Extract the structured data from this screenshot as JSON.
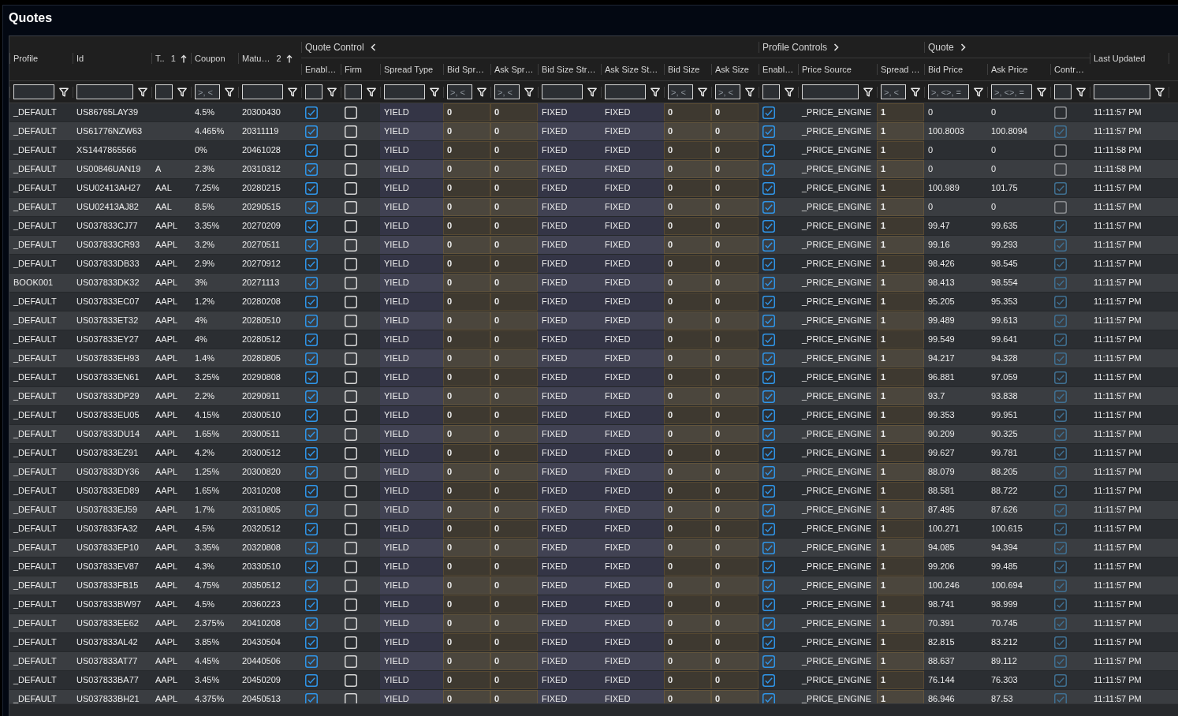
{
  "title": "Quotes",
  "grid": {
    "headers": [
      {
        "kind": "text",
        "label": "Profile"
      },
      {
        "kind": "text",
        "label": "Id"
      },
      {
        "kind": "text",
        "label": "T..",
        "sort_index": "1",
        "ascending": true
      },
      {
        "kind": "text",
        "label": "Coupon",
        "filter_placeholder": ">, <"
      },
      {
        "kind": "text",
        "label": "Matu…",
        "sort_index": "2",
        "ascending": true
      },
      {
        "kind": "group",
        "label": "Quote Control",
        "expanded": true,
        "columns": [
          {
            "kind": "check",
            "label": "Enabl…"
          },
          {
            "kind": "check",
            "label": "Firm"
          },
          {
            "kind": "choice",
            "label": "Spread Type"
          },
          {
            "kind": "entry",
            "label": "Bid Spr…",
            "filter_placeholder": ">, <"
          },
          {
            "kind": "entry",
            "label": "Ask Spr…",
            "filter_placeholder": ">, <"
          },
          {
            "kind": "choice",
            "label": "Bid Size Str…"
          },
          {
            "kind": "choice",
            "label": "Ask Size St…"
          },
          {
            "kind": "entry",
            "label": "Bid Size",
            "filter_placeholder": ">, <"
          },
          {
            "kind": "entry",
            "label": "Ask Size",
            "filter_placeholder": ">, <"
          }
        ]
      },
      {
        "kind": "group",
        "label": "Profile Controls",
        "expanded": false,
        "columns": [
          {
            "kind": "check",
            "label": "Enabl…"
          },
          {
            "kind": "text",
            "label": "Price Source"
          },
          {
            "kind": "entry",
            "label": "Spread …",
            "filter_placeholder": ">, <"
          }
        ]
      },
      {
        "kind": "group",
        "label": "Quote",
        "expanded": false,
        "columns": [
          {
            "kind": "text",
            "label": "Bid Price",
            "filter_placeholder": ">, <>, ="
          },
          {
            "kind": "text",
            "label": "Ask Price",
            "filter_placeholder": ">, <>, ="
          },
          {
            "kind": "flag",
            "label": "Contr…"
          }
        ]
      },
      {
        "kind": "text",
        "label": "Last Updated"
      }
    ],
    "rows": [
      {
        "cells": [
          "_DEFAULT",
          "US86765LAY39",
          null,
          "4.5%",
          "20300430",
          true,
          false,
          "YIELD",
          "0",
          "0",
          "FIXED",
          "FIXED",
          "0",
          "0",
          true,
          "_PRICE_ENGINE",
          "1",
          "0",
          "0",
          false,
          "11:11:57 PM"
        ]
      },
      {
        "cells": [
          "_DEFAULT",
          "US61776NZW63",
          null,
          "4.465%",
          "20311119",
          true,
          false,
          "YIELD",
          "0",
          "0",
          "FIXED",
          "FIXED",
          "0",
          "0",
          true,
          "_PRICE_ENGINE",
          "1",
          "100.8003",
          "100.8094",
          true,
          "11:11:57 PM"
        ]
      },
      {
        "cells": [
          "_DEFAULT",
          "XS1447865566",
          null,
          "0%",
          "20461028",
          true,
          false,
          "YIELD",
          "0",
          "0",
          "FIXED",
          "FIXED",
          "0",
          "0",
          true,
          "_PRICE_ENGINE",
          "1",
          "0",
          "0",
          false,
          "11:11:58 PM"
        ]
      },
      {
        "cells": [
          "_DEFAULT",
          "US00846UAN19",
          "A",
          "2.3%",
          "20310312",
          true,
          false,
          "YIELD",
          "0",
          "0",
          "FIXED",
          "FIXED",
          "0",
          "0",
          true,
          "_PRICE_ENGINE",
          "1",
          "0",
          "0",
          false,
          "11:11:58 PM"
        ]
      },
      {
        "cells": [
          "_DEFAULT",
          "USU02413AH27",
          "AAL",
          "7.25%",
          "20280215",
          true,
          false,
          "YIELD",
          "0",
          "0",
          "FIXED",
          "FIXED",
          "0",
          "0",
          true,
          "_PRICE_ENGINE",
          "1",
          "100.989",
          "101.75",
          true,
          "11:11:57 PM"
        ]
      },
      {
        "cells": [
          "_DEFAULT",
          "USU02413AJ82",
          "AAL",
          "8.5%",
          "20290515",
          true,
          false,
          "YIELD",
          "0",
          "0",
          "FIXED",
          "FIXED",
          "0",
          "0",
          true,
          "_PRICE_ENGINE",
          "1",
          "0",
          "0",
          false,
          "11:11:57 PM"
        ]
      },
      {
        "cells": [
          "_DEFAULT",
          "US037833CJ77",
          "AAPL",
          "3.35%",
          "20270209",
          true,
          false,
          "YIELD",
          "0",
          "0",
          "FIXED",
          "FIXED",
          "0",
          "0",
          true,
          "_PRICE_ENGINE",
          "1",
          "99.47",
          "99.635",
          true,
          "11:11:57 PM"
        ]
      },
      {
        "cells": [
          "_DEFAULT",
          "US037833CR93",
          "AAPL",
          "3.2%",
          "20270511",
          true,
          false,
          "YIELD",
          "0",
          "0",
          "FIXED",
          "FIXED",
          "0",
          "0",
          true,
          "_PRICE_ENGINE",
          "1",
          "99.16",
          "99.293",
          true,
          "11:11:57 PM"
        ]
      },
      {
        "cells": [
          "_DEFAULT",
          "US037833DB33",
          "AAPL",
          "2.9%",
          "20270912",
          true,
          false,
          "YIELD",
          "0",
          "0",
          "FIXED",
          "FIXED",
          "0",
          "0",
          true,
          "_PRICE_ENGINE",
          "1",
          "98.426",
          "98.545",
          true,
          "11:11:57 PM"
        ]
      },
      {
        "cells": [
          "BOOK001",
          "US037833DK32",
          "AAPL",
          "3%",
          "20271113",
          true,
          false,
          "YIELD",
          "0",
          "0",
          "FIXED",
          "FIXED",
          "0",
          "0",
          true,
          "_PRICE_ENGINE",
          "1",
          "98.413",
          "98.554",
          true,
          "11:11:57 PM"
        ]
      },
      {
        "cells": [
          "_DEFAULT",
          "US037833EC07",
          "AAPL",
          "1.2%",
          "20280208",
          true,
          false,
          "YIELD",
          "0",
          "0",
          "FIXED",
          "FIXED",
          "0",
          "0",
          true,
          "_PRICE_ENGINE",
          "1",
          "95.205",
          "95.353",
          true,
          "11:11:57 PM"
        ]
      },
      {
        "cells": [
          "_DEFAULT",
          "US037833ET32",
          "AAPL",
          "4%",
          "20280510",
          true,
          false,
          "YIELD",
          "0",
          "0",
          "FIXED",
          "FIXED",
          "0",
          "0",
          true,
          "_PRICE_ENGINE",
          "1",
          "99.489",
          "99.613",
          true,
          "11:11:57 PM"
        ]
      },
      {
        "cells": [
          "_DEFAULT",
          "US037833EY27",
          "AAPL",
          "4%",
          "20280512",
          true,
          false,
          "YIELD",
          "0",
          "0",
          "FIXED",
          "FIXED",
          "0",
          "0",
          true,
          "_PRICE_ENGINE",
          "1",
          "99.549",
          "99.641",
          true,
          "11:11:57 PM"
        ]
      },
      {
        "cells": [
          "_DEFAULT",
          "US037833EH93",
          "AAPL",
          "1.4%",
          "20280805",
          true,
          false,
          "YIELD",
          "0",
          "0",
          "FIXED",
          "FIXED",
          "0",
          "0",
          true,
          "_PRICE_ENGINE",
          "1",
          "94.217",
          "94.328",
          true,
          "11:11:57 PM"
        ]
      },
      {
        "cells": [
          "_DEFAULT",
          "US037833EN61",
          "AAPL",
          "3.25%",
          "20290808",
          true,
          false,
          "YIELD",
          "0",
          "0",
          "FIXED",
          "FIXED",
          "0",
          "0",
          true,
          "_PRICE_ENGINE",
          "1",
          "96.881",
          "97.059",
          true,
          "11:11:57 PM"
        ]
      },
      {
        "cells": [
          "_DEFAULT",
          "US037833DP29",
          "AAPL",
          "2.2%",
          "20290911",
          true,
          false,
          "YIELD",
          "0",
          "0",
          "FIXED",
          "FIXED",
          "0",
          "0",
          true,
          "_PRICE_ENGINE",
          "1",
          "93.7",
          "93.838",
          true,
          "11:11:57 PM"
        ]
      },
      {
        "cells": [
          "_DEFAULT",
          "US037833EU05",
          "AAPL",
          "4.15%",
          "20300510",
          true,
          false,
          "YIELD",
          "0",
          "0",
          "FIXED",
          "FIXED",
          "0",
          "0",
          true,
          "_PRICE_ENGINE",
          "1",
          "99.353",
          "99.951",
          true,
          "11:11:57 PM"
        ]
      },
      {
        "cells": [
          "_DEFAULT",
          "US037833DU14",
          "AAPL",
          "1.65%",
          "20300511",
          true,
          false,
          "YIELD",
          "0",
          "0",
          "FIXED",
          "FIXED",
          "0",
          "0",
          true,
          "_PRICE_ENGINE",
          "1",
          "90.209",
          "90.325",
          true,
          "11:11:57 PM"
        ]
      },
      {
        "cells": [
          "_DEFAULT",
          "US037833EZ91",
          "AAPL",
          "4.2%",
          "20300512",
          true,
          false,
          "YIELD",
          "0",
          "0",
          "FIXED",
          "FIXED",
          "0",
          "0",
          true,
          "_PRICE_ENGINE",
          "1",
          "99.627",
          "99.781",
          true,
          "11:11:57 PM"
        ]
      },
      {
        "cells": [
          "_DEFAULT",
          "US037833DY36",
          "AAPL",
          "1.25%",
          "20300820",
          true,
          false,
          "YIELD",
          "0",
          "0",
          "FIXED",
          "FIXED",
          "0",
          "0",
          true,
          "_PRICE_ENGINE",
          "1",
          "88.079",
          "88.205",
          true,
          "11:11:57 PM"
        ]
      },
      {
        "cells": [
          "_DEFAULT",
          "US037833ED89",
          "AAPL",
          "1.65%",
          "20310208",
          true,
          false,
          "YIELD",
          "0",
          "0",
          "FIXED",
          "FIXED",
          "0",
          "0",
          true,
          "_PRICE_ENGINE",
          "1",
          "88.581",
          "88.722",
          true,
          "11:11:57 PM"
        ]
      },
      {
        "cells": [
          "_DEFAULT",
          "US037833EJ59",
          "AAPL",
          "1.7%",
          "20310805",
          true,
          false,
          "YIELD",
          "0",
          "0",
          "FIXED",
          "FIXED",
          "0",
          "0",
          true,
          "_PRICE_ENGINE",
          "1",
          "87.495",
          "87.626",
          true,
          "11:11:57 PM"
        ]
      },
      {
        "cells": [
          "_DEFAULT",
          "US037833FA32",
          "AAPL",
          "4.5%",
          "20320512",
          true,
          false,
          "YIELD",
          "0",
          "0",
          "FIXED",
          "FIXED",
          "0",
          "0",
          true,
          "_PRICE_ENGINE",
          "1",
          "100.271",
          "100.615",
          true,
          "11:11:57 PM"
        ]
      },
      {
        "cells": [
          "_DEFAULT",
          "US037833EP10",
          "AAPL",
          "3.35%",
          "20320808",
          true,
          false,
          "YIELD",
          "0",
          "0",
          "FIXED",
          "FIXED",
          "0",
          "0",
          true,
          "_PRICE_ENGINE",
          "1",
          "94.085",
          "94.394",
          true,
          "11:11:57 PM"
        ]
      },
      {
        "cells": [
          "_DEFAULT",
          "US037833EV87",
          "AAPL",
          "4.3%",
          "20330510",
          true,
          false,
          "YIELD",
          "0",
          "0",
          "FIXED",
          "FIXED",
          "0",
          "0",
          true,
          "_PRICE_ENGINE",
          "1",
          "99.206",
          "99.485",
          true,
          "11:11:57 PM"
        ]
      },
      {
        "cells": [
          "_DEFAULT",
          "US037833FB15",
          "AAPL",
          "4.75%",
          "20350512",
          true,
          false,
          "YIELD",
          "0",
          "0",
          "FIXED",
          "FIXED",
          "0",
          "0",
          true,
          "_PRICE_ENGINE",
          "1",
          "100.246",
          "100.694",
          true,
          "11:11:57 PM"
        ]
      },
      {
        "cells": [
          "_DEFAULT",
          "US037833BW97",
          "AAPL",
          "4.5%",
          "20360223",
          true,
          false,
          "YIELD",
          "0",
          "0",
          "FIXED",
          "FIXED",
          "0",
          "0",
          true,
          "_PRICE_ENGINE",
          "1",
          "98.741",
          "98.999",
          true,
          "11:11:57 PM"
        ]
      },
      {
        "cells": [
          "_DEFAULT",
          "US037833EE62",
          "AAPL",
          "2.375%",
          "20410208",
          true,
          false,
          "YIELD",
          "0",
          "0",
          "FIXED",
          "FIXED",
          "0",
          "0",
          true,
          "_PRICE_ENGINE",
          "1",
          "70.391",
          "70.745",
          true,
          "11:11:57 PM"
        ]
      },
      {
        "cells": [
          "_DEFAULT",
          "US037833AL42",
          "AAPL",
          "3.85%",
          "20430504",
          true,
          false,
          "YIELD",
          "0",
          "0",
          "FIXED",
          "FIXED",
          "0",
          "0",
          true,
          "_PRICE_ENGINE",
          "1",
          "82.815",
          "83.212",
          true,
          "11:11:57 PM"
        ]
      },
      {
        "cells": [
          "_DEFAULT",
          "US037833AT77",
          "AAPL",
          "4.45%",
          "20440506",
          true,
          false,
          "YIELD",
          "0",
          "0",
          "FIXED",
          "FIXED",
          "0",
          "0",
          true,
          "_PRICE_ENGINE",
          "1",
          "88.637",
          "89.112",
          true,
          "11:11:57 PM"
        ]
      },
      {
        "cells": [
          "_DEFAULT",
          "US037833BA77",
          "AAPL",
          "3.45%",
          "20450209",
          true,
          false,
          "YIELD",
          "0",
          "0",
          "FIXED",
          "FIXED",
          "0",
          "0",
          true,
          "_PRICE_ENGINE",
          "1",
          "76.144",
          "76.303",
          true,
          "11:11:57 PM"
        ]
      },
      {
        "cells": [
          "_DEFAULT",
          "US037833BH21",
          "AAPL",
          "4.375%",
          "20450513",
          true,
          false,
          "YIELD",
          "0",
          "0",
          "FIXED",
          "FIXED",
          "0",
          "0",
          true,
          "_PRICE_ENGINE",
          "1",
          "86.946",
          "87.53",
          true,
          "11:11:57 PM"
        ]
      }
    ]
  }
}
